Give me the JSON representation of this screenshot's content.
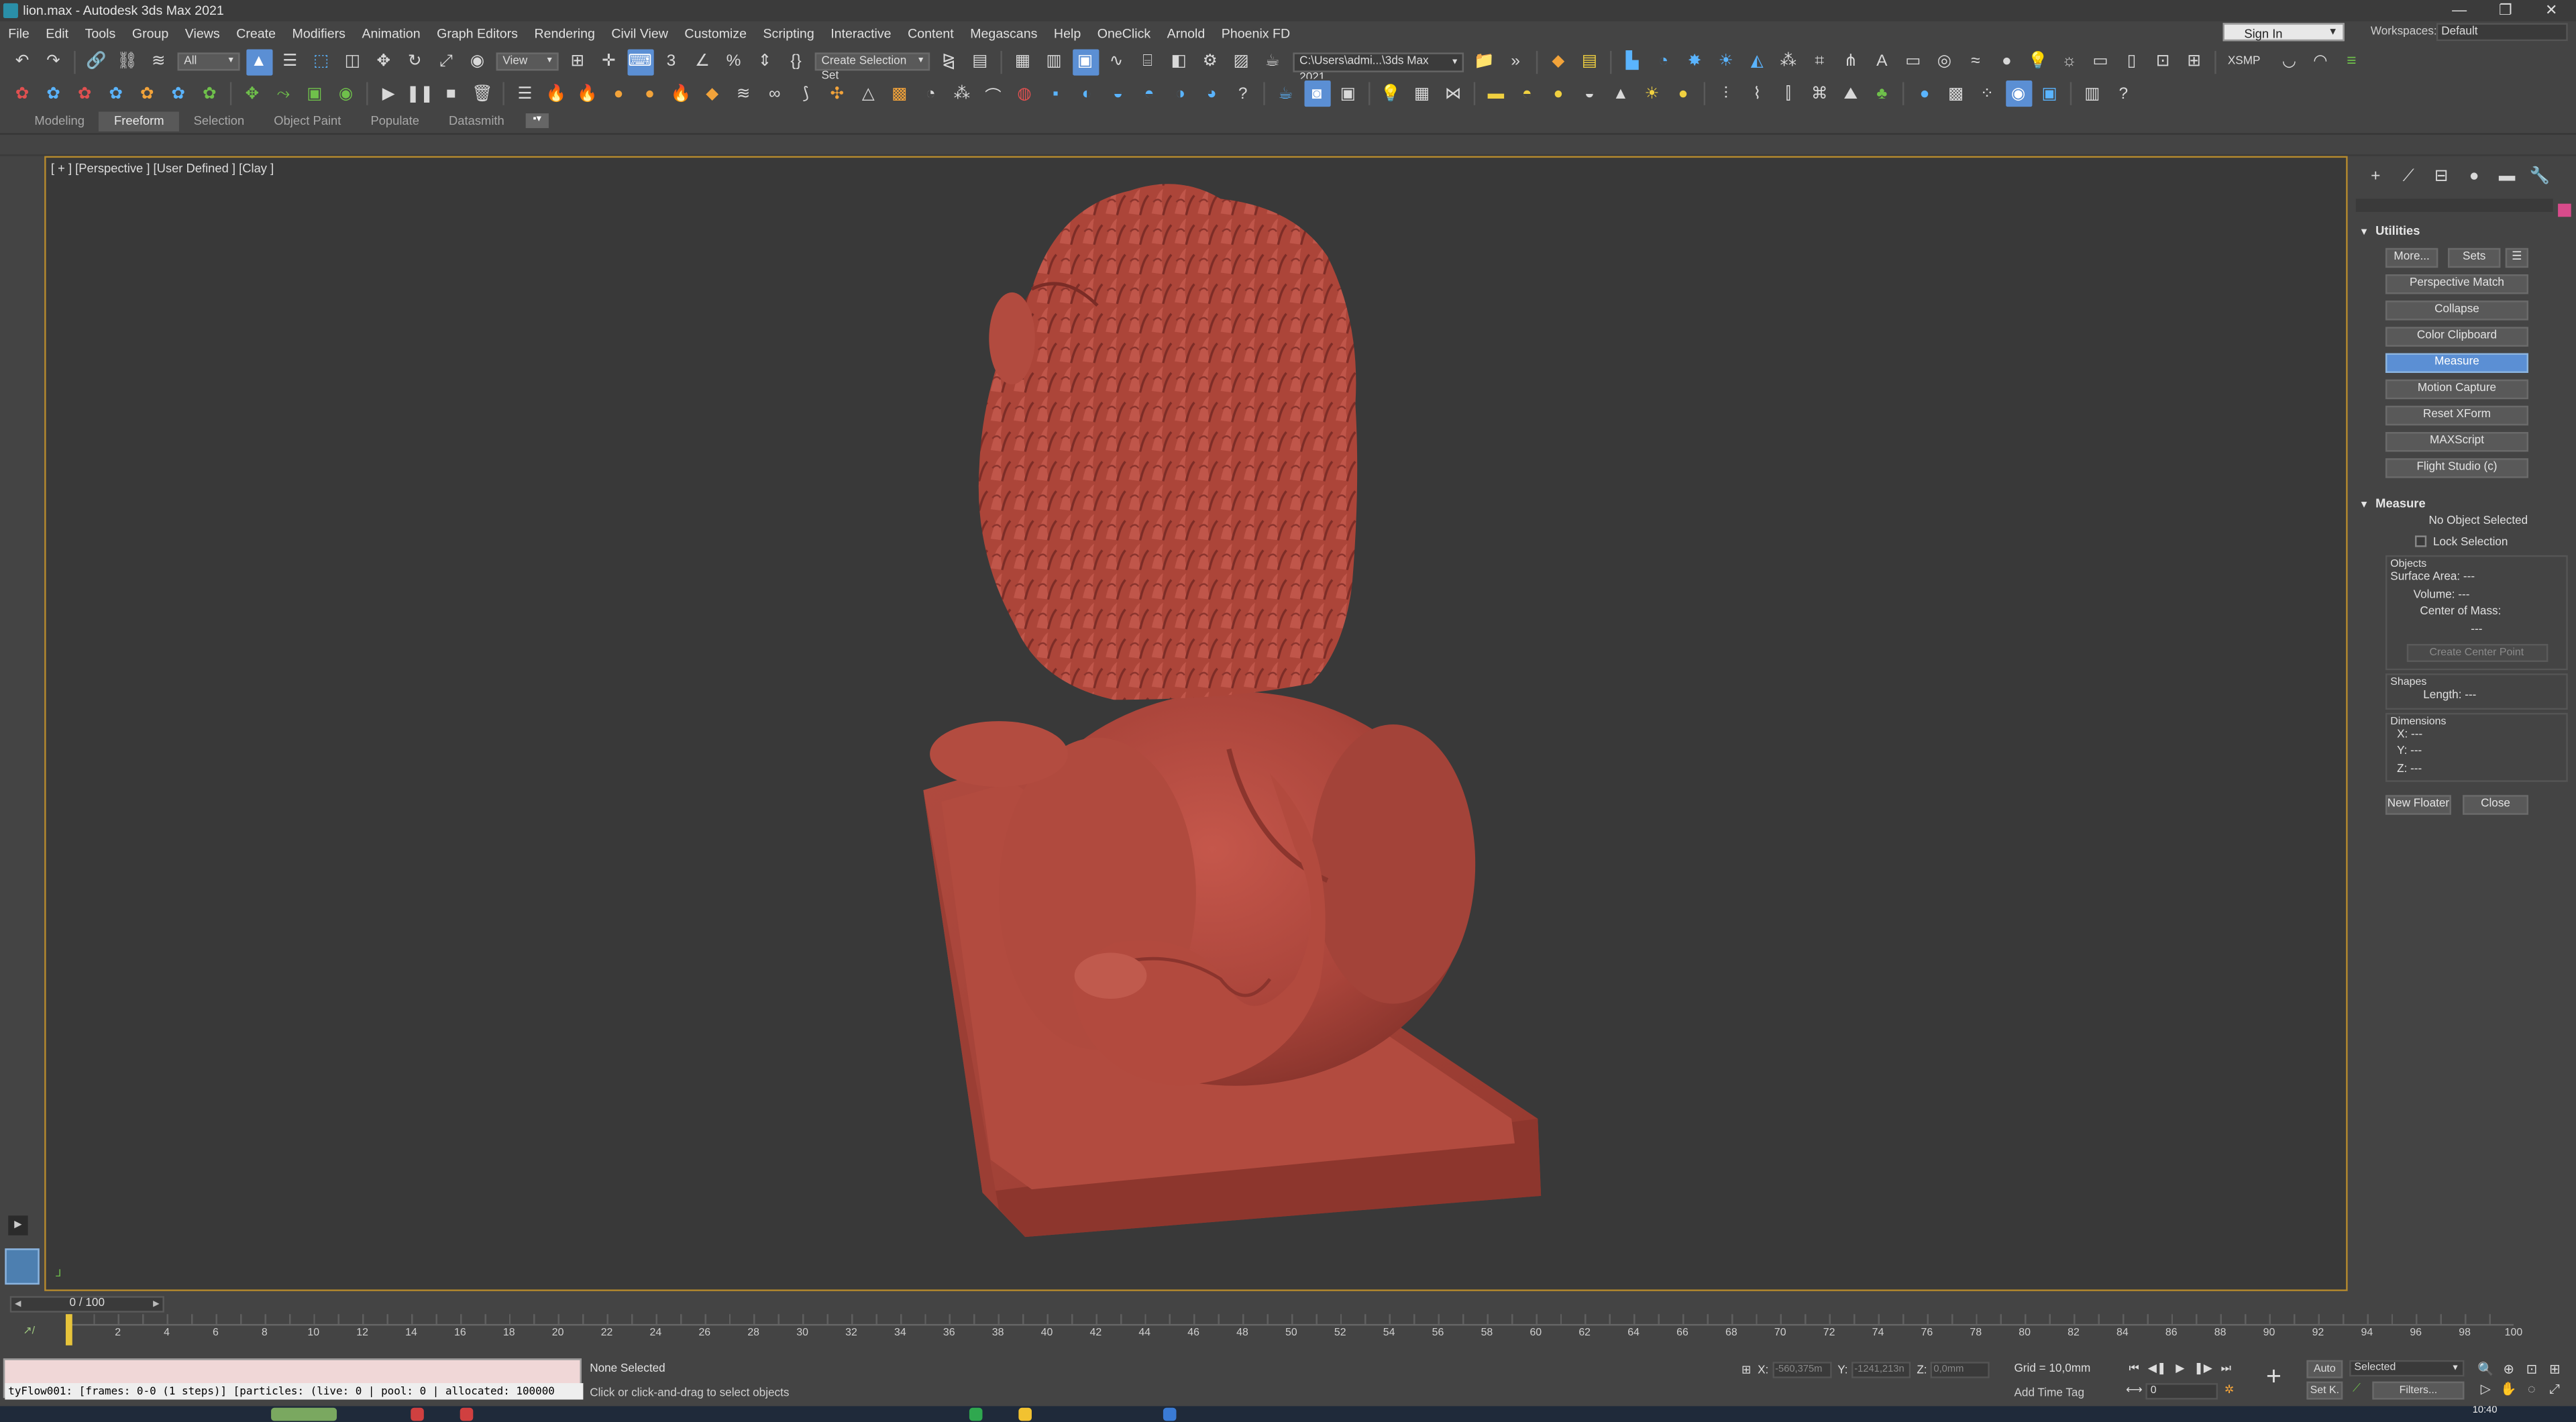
{
  "window": {
    "title": "lion.max - Autodesk 3ds Max 2021",
    "minimize": "—",
    "maximize": "❐",
    "close": "✕"
  },
  "menu": [
    "File",
    "Edit",
    "Tools",
    "Group",
    "Views",
    "Create",
    "Modifiers",
    "Animation",
    "Graph Editors",
    "Rendering",
    "Civil View",
    "Customize",
    "Scripting",
    "Interactive",
    "Content",
    "Megascans",
    "Help",
    "OneClick",
    "Arnold",
    "Phoenix FD"
  ],
  "account": {
    "sign_in": "Sign In",
    "workspaces_label": "Workspaces:",
    "workspace_value": "Default"
  },
  "toolbar": {
    "filter_dropdown": "All",
    "ref_coord_dropdown": "View",
    "selection_set": "Create Selection Set",
    "project_path": "C:\\Users\\admi...\\3ds Max 2021",
    "xsmp": "XSMP"
  },
  "ribbon": {
    "tabs": [
      "Modeling",
      "Freeform",
      "Selection",
      "Object Paint",
      "Populate",
      "Datasmith"
    ],
    "active_tab": "Freeform"
  },
  "viewport": {
    "label": "[ + ] [Perspective ] [User Defined ] [Clay ]",
    "model_color": "#b5463b"
  },
  "command_panel": {
    "utilities": {
      "header": "Utilities",
      "more": "More...",
      "sets": "Sets",
      "buttons": [
        "Perspective Match",
        "Collapse",
        "Color Clipboard",
        "Measure",
        "Motion Capture",
        "Reset XForm",
        "MAXScript",
        "Flight Studio (c)"
      ],
      "active": "Measure"
    },
    "measure": {
      "header": "Measure",
      "status": "No Object Selected",
      "lock_selection": "Lock Selection",
      "objects_label": "Objects",
      "surface_area": "Surface Area:  ---",
      "volume": "Volume:  ---",
      "center_of_mass": "Center of Mass:",
      "center_value": "---",
      "create_center_point": "Create Center Point",
      "shapes_label": "Shapes",
      "length": "Length:  ---",
      "dimensions_label": "Dimensions",
      "x": "X:  ---",
      "y": "Y:  ---",
      "z": "Z:  ---",
      "new_floater": "New Floater",
      "close": "Close"
    }
  },
  "timeline": {
    "slider": "0 / 100",
    "ticks": [
      "0",
      "2",
      "4",
      "6",
      "8",
      "10",
      "12",
      "14",
      "16",
      "18",
      "20",
      "22",
      "24",
      "26",
      "28",
      "30",
      "32",
      "34",
      "36",
      "38",
      "40",
      "42",
      "44",
      "46",
      "48",
      "50",
      "52",
      "54",
      "56",
      "58",
      "60",
      "62",
      "64",
      "66",
      "68",
      "70",
      "72",
      "74",
      "76",
      "78",
      "80",
      "82",
      "84",
      "86",
      "88",
      "90",
      "92",
      "94",
      "96",
      "98",
      "100"
    ],
    "current_frame": 0
  },
  "status": {
    "tyflow": "tyFlow001: [frames: 0-0 (1 steps)] [particles: (live: 0 | pool: 0 | allocated: 100000",
    "selection": "None Selected",
    "prompt": "Click or click-and-drag to select objects",
    "x_label": "X:",
    "x_value": "-560,375m",
    "y_label": "Y:",
    "y_value": "-1241,213n",
    "z_label": "Z:",
    "z_value": "0,0mm",
    "grid": "Grid = 10,0mm",
    "add_time_tag": "Add Time Tag",
    "auto": "Auto",
    "set_key": "Set K.",
    "selected_dropdown": "Selected",
    "filters": "Filters...",
    "frame_box": "0",
    "clock": "10:40"
  }
}
